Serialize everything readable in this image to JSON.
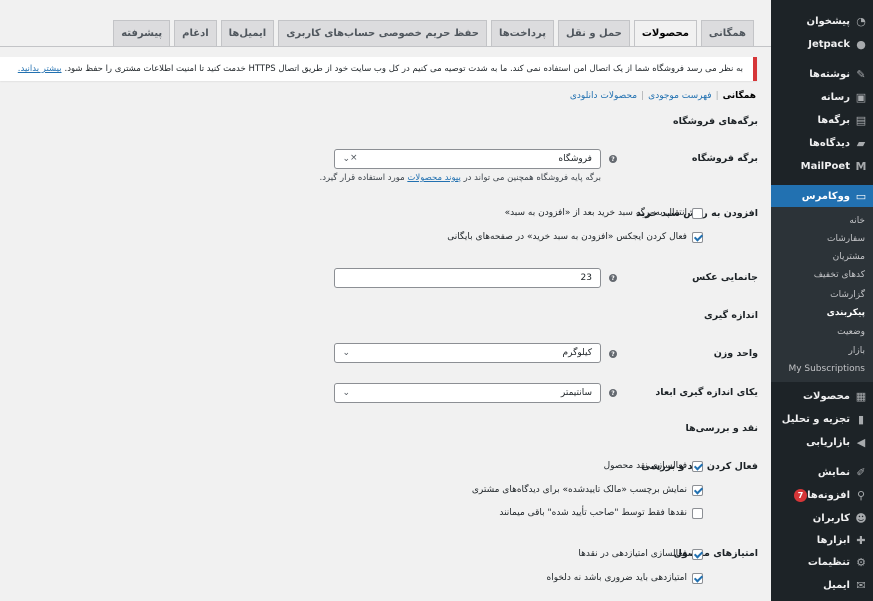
{
  "tabs": [
    "همگانی",
    "محصولات",
    "حمل و نقل",
    "پرداخت‌ها",
    "حفظ حریم خصوصی حساب‌های کاربری",
    "ایمیل‌ها",
    "ادغام",
    "پیشرفته"
  ],
  "notice": {
    "text": "به نظر می رسد فروشگاه شما از یک اتصال امن استفاده نمی کند. ما به شدت توصیه می کنیم در کل وب سایت خود از طریق اتصال HTTPS خدمت کنید تا امنیت اطلاعات مشتری را حفظ شود.",
    "link": "بیشتر بدانید."
  },
  "subnav": {
    "current": "همگانی",
    "link1": "فهرست موجودی",
    "link2": "محصولات دانلودی",
    "sep": "|"
  },
  "sections": {
    "shop_pages": "برگه‌های فروشگاه",
    "measurements": "اندازه گیری",
    "reviews": "نقد و بررسی‌ها"
  },
  "fields": {
    "shop_page": {
      "label": "برگه فروشگاه",
      "value": "فروشگاه",
      "desc_before": "برگه پایه فروشگاه همچنین می تواند در",
      "desc_link": "پیوند محصولات",
      "desc_after": "مورد استفاده قرار گیرد."
    },
    "add_to_cart": {
      "label": "افزودن به روش سبد خرید",
      "opt1": "انتقال به برگه سبد خرید بعد از «افزودن به سبد»",
      "opt2": "فعال کردن ایجکس «افزودن به سبد خرید» در صفحه‌های بایگانی"
    },
    "placeholder_image": {
      "label": "جانمایی عکس",
      "value": "23"
    },
    "weight_unit": {
      "label": "واحد وزن",
      "value": "کیلوگرم"
    },
    "dimension_unit": {
      "label": "یکای اندازه گیری ابعاد",
      "value": "سانتیمتر"
    },
    "enable_reviews": {
      "label": "فعال کردن نقد و بررسی",
      "opt1": "فعالسازی نقد محصول",
      "opt2": "نمایش برچسب «مالک تاییدشده» برای دیدگاه‌های مشتری",
      "opt3": "نقدها فقط توسط \"صاحب تأیید شده\" باقی میمانند"
    },
    "product_ratings": {
      "label": "امتیازهای محصول",
      "opt1": "فعالسازی امتیازدهی در نقدها",
      "opt2": "امتیازدهی باید ضروری باشد نه دلخواه"
    }
  },
  "sidebar": {
    "items": [
      {
        "label": "پیشخوان",
        "icon": "dashboard-icon"
      },
      {
        "label": "Jetpack",
        "icon": "jetpack-icon"
      },
      {
        "label": "نوشته‌ها",
        "icon": "pin-icon"
      },
      {
        "label": "رسانه",
        "icon": "media-icon"
      },
      {
        "label": "برگه‌ها",
        "icon": "page-icon"
      },
      {
        "label": "دیدگاه‌ها",
        "icon": "comment-icon"
      },
      {
        "label": "MailPoet",
        "icon": "mailpoet-icon"
      },
      {
        "label": "ووکامرس",
        "icon": "woo-icon"
      }
    ],
    "sub": [
      "خانه",
      "سفارشات",
      "مشتریان",
      "کدهای تخفیف",
      "گزارشات",
      "پیکربندی",
      "وضعیت",
      "بازار",
      "My Subscriptions"
    ],
    "items2": [
      {
        "label": "محصولات",
        "icon": "products-icon"
      },
      {
        "label": "تجزیه و تحلیل",
        "icon": "analytics-icon"
      },
      {
        "label": "بازاریابی",
        "icon": "marketing-icon"
      },
      {
        "label": "نمایش",
        "icon": "appearance-icon"
      },
      {
        "label": "افزونه‌ها",
        "icon": "plugins-icon",
        "badge": "7"
      },
      {
        "label": "کاربران",
        "icon": "users-icon"
      },
      {
        "label": "ابزارها",
        "icon": "tools-icon"
      },
      {
        "label": "تنظیمات",
        "icon": "settings-icon"
      },
      {
        "label": "ایمیل",
        "icon": "email-icon"
      }
    ]
  }
}
